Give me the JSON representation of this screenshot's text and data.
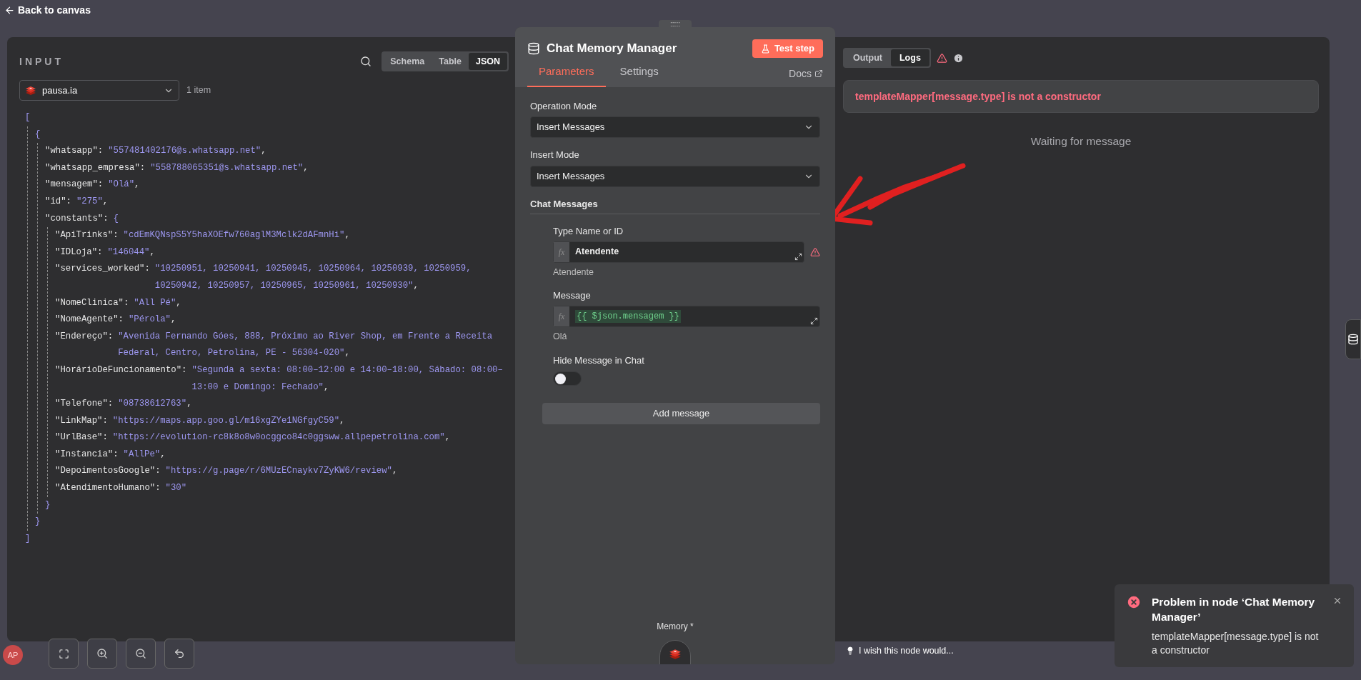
{
  "top_bar": {
    "back_label": "Back to canvas"
  },
  "input_panel": {
    "title": "INPUT",
    "view_tabs": [
      {
        "label": "Schema",
        "selected": false
      },
      {
        "label": "Table",
        "selected": false
      },
      {
        "label": "JSON",
        "selected": true
      }
    ],
    "source": "pausa.ia",
    "item_count": "1 item",
    "json_view": {
      "open": "[",
      "close": "]",
      "children": [
        {
          "open": "{",
          "close": "}",
          "children": [
            {
              "key": "\"whatsapp\":",
              "value": "\"557481402176@s.whatsapp.net\"",
              "comma": ","
            },
            {
              "key": "\"whatsapp_empresa\":",
              "value": "\"558788065351@s.whatsapp.net\"",
              "comma": ","
            },
            {
              "key": "\"mensagem\":",
              "value": "\"Olá\"",
              "comma": ","
            },
            {
              "key": "\"id\":",
              "value": "\"275\"",
              "comma": ","
            },
            {
              "key": "\"constants\":",
              "open": "{",
              "close": "}",
              "children": [
                {
                  "key": "\"ApiTrinks\":",
                  "value": "\"cdEmKQNspS5Y5haXOEfw760aglM3Mclk2dAFmnHi\"",
                  "comma": ","
                },
                {
                  "key": "\"IDLoja\":",
                  "value": "\"146044\"",
                  "comma": ","
                },
                {
                  "key": "\"services_worked\":",
                  "value": "\"10250951, 10250941, 10250945, 10250964, 10250939, 10250959, 10250942, 10250957, 10250965, 10250961, 10250930\"",
                  "comma": ","
                },
                {
                  "key": "\"NomeClinica\":",
                  "value": "\"All Pé\"",
                  "comma": ","
                },
                {
                  "key": "\"NomeAgente\":",
                  "value": "\"Pérola\"",
                  "comma": ","
                },
                {
                  "key": "\"Endereço\":",
                  "value": "\"Avenida Fernando Góes, 888, Próximo ao River Shop, em Frente a Receita Federal, Centro, Petrolina, PE - 56304-020\"",
                  "comma": ","
                },
                {
                  "key": "\"HorárioDeFuncionamento\":",
                  "value": "\"Segunda a sexta: 08:00–12:00 e 14:00–18:00, Sábado: 08:00–13:00 e Domingo: Fechado\"",
                  "comma": ","
                },
                {
                  "key": "\"Telefone\":",
                  "value": "\"08738612763\"",
                  "comma": ","
                },
                {
                  "key": "\"LinkMap\":",
                  "value": "\"https://maps.app.goo.gl/m16xgZYe1NGfgyC59\"",
                  "comma": ","
                },
                {
                  "key": "\"UrlBase\":",
                  "value": "\"https://evolution-rc8k8o8w0ocggco84c0ggsww.allpepetrolina.com\"",
                  "comma": ","
                },
                {
                  "key": "\"Instancia\":",
                  "value": "\"AllPe\"",
                  "comma": ","
                },
                {
                  "key": "\"DepoimentosGoogle\":",
                  "value": "\"https://g.page/r/6MUzECnaykv7ZyKW6/review\"",
                  "comma": ","
                },
                {
                  "key": "\"AtendimentoHumano\":",
                  "value": "\"30\""
                }
              ]
            }
          ]
        }
      ]
    }
  },
  "node_panel": {
    "handle": ":::::",
    "title": "Chat Memory Manager",
    "test_button": "Test step",
    "tabs": [
      {
        "label": "Parameters",
        "selected": true
      },
      {
        "label": "Settings",
        "selected": false
      }
    ],
    "docs_link": "Docs",
    "fields": [
      {
        "kind": "select",
        "label": "Operation Mode",
        "value": "Insert Messages"
      },
      {
        "kind": "select",
        "label": "Insert Mode",
        "value": "Insert Messages"
      },
      {
        "kind": "section",
        "label": "Chat Messages"
      }
    ],
    "messages": [
      {
        "kind": "text",
        "label": "Type Name or ID",
        "fx": "fx",
        "value": "Atendente",
        "hint": "Atendente",
        "warning": true
      },
      {
        "kind": "expression",
        "label": "Message",
        "fx": "fx",
        "value": "{{ $json.mensagem }}",
        "hint": "Olá",
        "warning": false
      },
      {
        "kind": "toggle",
        "label": "Hide Message in Chat",
        "on": false
      }
    ],
    "add_button": "Add message",
    "footer_label": "Memory *"
  },
  "output_panel": {
    "tabs": [
      {
        "label": "Output",
        "selected": false
      },
      {
        "label": "Logs",
        "selected": true
      }
    ],
    "error": "templateMapper[message.type] is not a constructor",
    "status": "Waiting for message"
  },
  "avatar": "AP",
  "feedback_link": "I wish this node would...",
  "toast": {
    "title": "Problem in node ‘Chat Memory Manager’",
    "message": "templateMapper[message.type] is not a constructor"
  }
}
